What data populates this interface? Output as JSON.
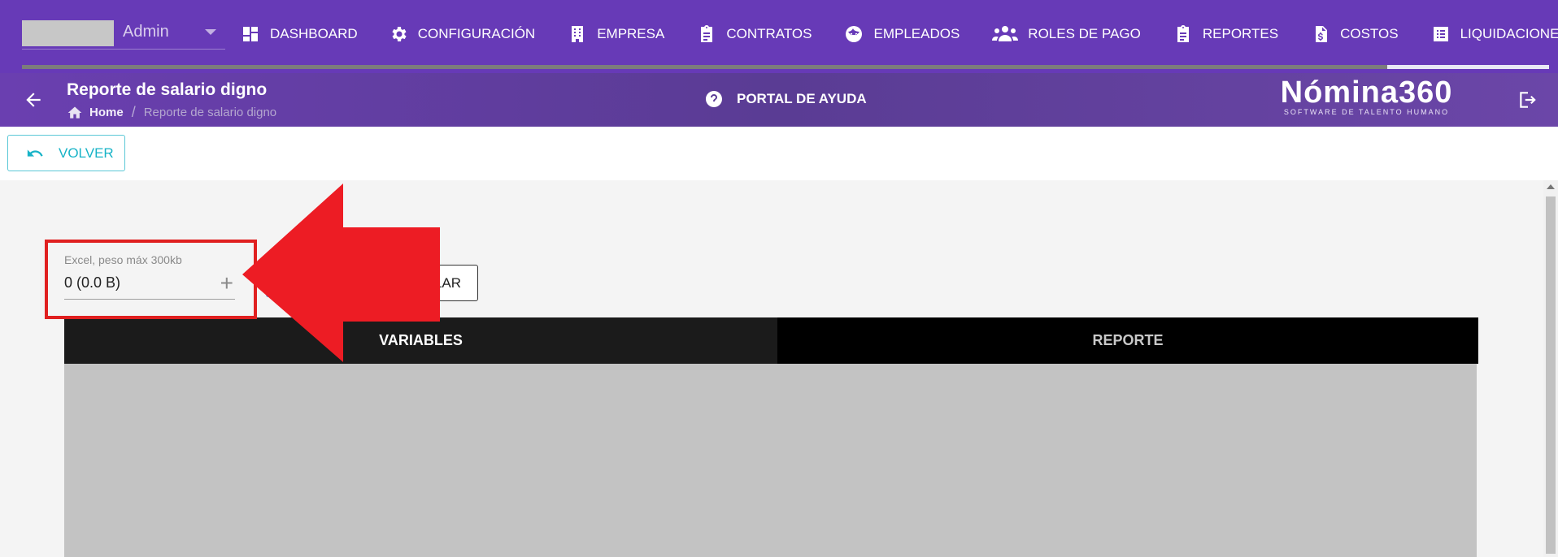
{
  "topnav": {
    "user": {
      "name": "Admin"
    },
    "items": [
      {
        "label": "DASHBOARD",
        "icon": "dashboard-icon"
      },
      {
        "label": "CONFIGURACIÓN",
        "icon": "gear-icon"
      },
      {
        "label": "EMPRESA",
        "icon": "building-icon"
      },
      {
        "label": "CONTRATOS",
        "icon": "clipboard-icon"
      },
      {
        "label": "EMPLEADOS",
        "icon": "face-icon"
      },
      {
        "label": "ROLES DE PAGO",
        "icon": "people-icon"
      },
      {
        "label": "REPORTES",
        "icon": "clipboard-icon"
      },
      {
        "label": "COSTOS",
        "icon": "file-dollar-icon"
      },
      {
        "label": "LIQUIDACIONES",
        "icon": "list-icon"
      }
    ],
    "colors": {
      "background": "#673ab7"
    }
  },
  "subheader": {
    "title": "Reporte de salario digno",
    "breadcrumb": {
      "home": "Home",
      "separator": "/",
      "current": "Reporte de salario digno"
    },
    "help_label": "PORTAL DE AYUDA",
    "brand": {
      "name": "Nómina360",
      "tagline": "SOFTWARE DE TALENTO HUMANO"
    }
  },
  "toolbar": {
    "back_label": "VOLVER",
    "accent": "#17b3c7"
  },
  "upload": {
    "label": "Excel, peso máx 300kb",
    "value": "0 (0.0 B)",
    "add_symbol": "+"
  },
  "cancel_button": {
    "visible_label": "LAR"
  },
  "tabs": [
    {
      "label": "VARIABLES",
      "active": true
    },
    {
      "label": "REPORTE",
      "active": false
    }
  ],
  "annotation": {
    "color": "#e02020"
  }
}
